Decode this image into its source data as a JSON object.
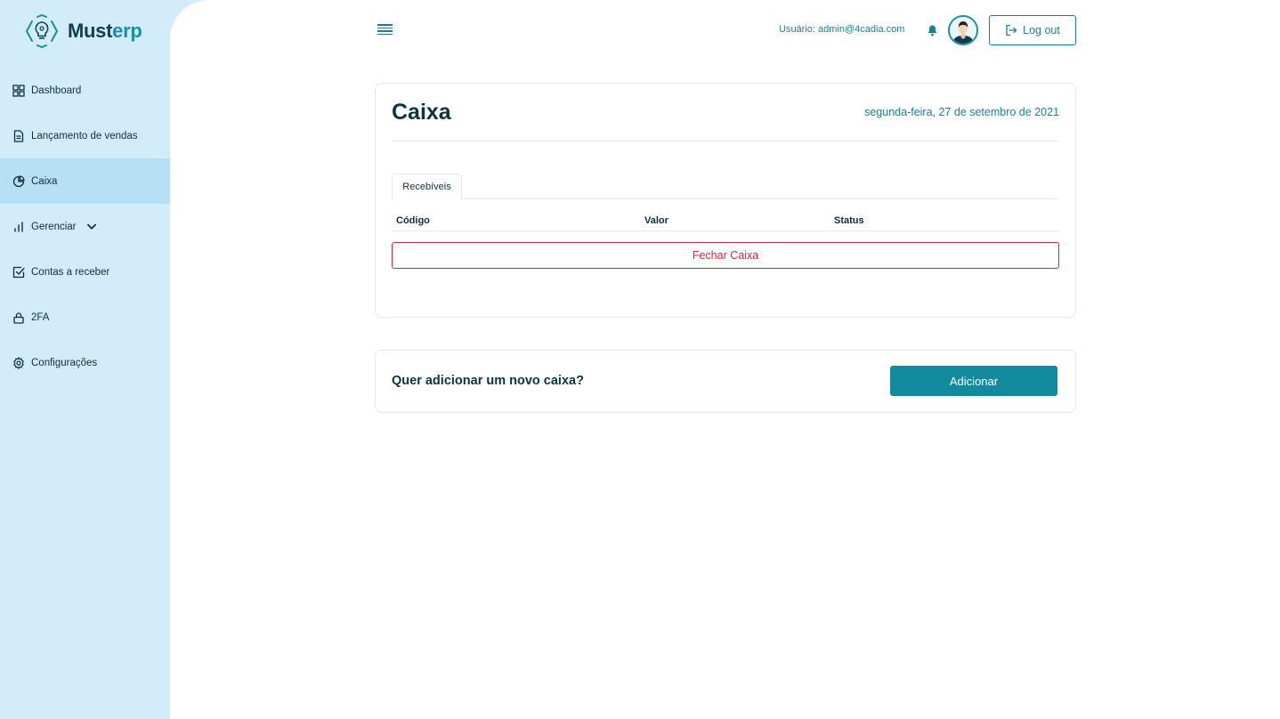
{
  "brand": {
    "name_part1": "Must",
    "name_part2": "erp"
  },
  "sidebar": {
    "items": [
      {
        "label": "Dashboard",
        "icon": "grid-icon"
      },
      {
        "label": "Lançamento de vendas",
        "icon": "document-icon"
      },
      {
        "label": "Caixa",
        "icon": "pie-chart-icon",
        "active": true
      },
      {
        "label": "Gerenciar",
        "icon": "bar-chart-icon",
        "has_dropdown": true
      },
      {
        "label": "Contas a receber",
        "icon": "check-square-icon"
      },
      {
        "label": "2FA",
        "icon": "lock-icon"
      },
      {
        "label": "Configurações",
        "icon": "gear-icon"
      }
    ]
  },
  "header": {
    "user_label": "Usuário: admin@4cadia.com",
    "logout_label": "Log out"
  },
  "caixa_card": {
    "title": "Caixa",
    "date": "segunda-feira, 27 de setembro de 2021",
    "tab": "Recebíveis",
    "columns": [
      "Código",
      "Valor",
      "Status"
    ],
    "close_button": "Fechar Caixa"
  },
  "add_card": {
    "question": "Quer adicionar um novo caixa?",
    "button": "Adicionar"
  },
  "colors": {
    "sidebar_bg": "#d3ecfa",
    "accent": "#138a9e",
    "danger": "#d0283f",
    "dark_text": "#0b3442"
  }
}
